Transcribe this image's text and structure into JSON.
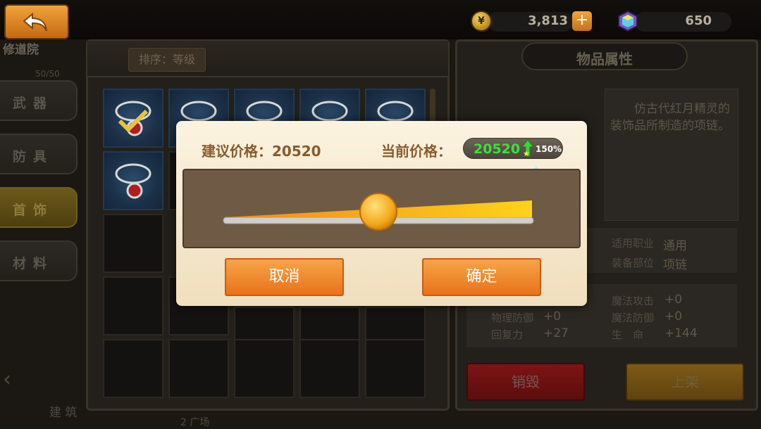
{
  "header": {
    "back_icon": "undo-arrow-icon",
    "coins": "3,813",
    "coin_plus": "+",
    "coin_icon": "gold-coin-icon",
    "gems": "650",
    "gem_icon": "gem-icon",
    "page_title": "修道院",
    "faint_number": "50/50"
  },
  "sidebar": {
    "items": [
      {
        "label": "武器"
      },
      {
        "label": "防具"
      },
      {
        "label": "首饰"
      },
      {
        "label": "材料"
      }
    ],
    "active": "首饰"
  },
  "inventory": {
    "sort_label": "排序：等级"
  },
  "detail": {
    "title": "物品属性",
    "description": "　　仿古代红月精灵的装饰品所制造的项链。",
    "job_label": "适用职业",
    "job_value": "通用",
    "slot_label": "装备部位",
    "slot_value": "项链",
    "stats": [
      {
        "label": "魔法攻击",
        "value": "+0"
      },
      {
        "label": "物理防御",
        "value": "+0"
      },
      {
        "label": "魔法防御",
        "value": "+0"
      },
      {
        "label": "回复力",
        "value": "+27"
      },
      {
        "label": "生　命",
        "value": "+144"
      }
    ],
    "destroy_label": "销毁",
    "list_label": "上架"
  },
  "bottom": {
    "left_text": "建 筑",
    "mid_text": "2  广场"
  },
  "dialog": {
    "suggest_label": "建议价格：20520",
    "current_label": "当前价格：",
    "current_price": "20520",
    "percent": "150%",
    "slider_value_fraction": 0.5,
    "cancel_label": "取消",
    "confirm_label": "确定",
    "accent_color": "#f08a24",
    "price_color": "#39e23a"
  }
}
